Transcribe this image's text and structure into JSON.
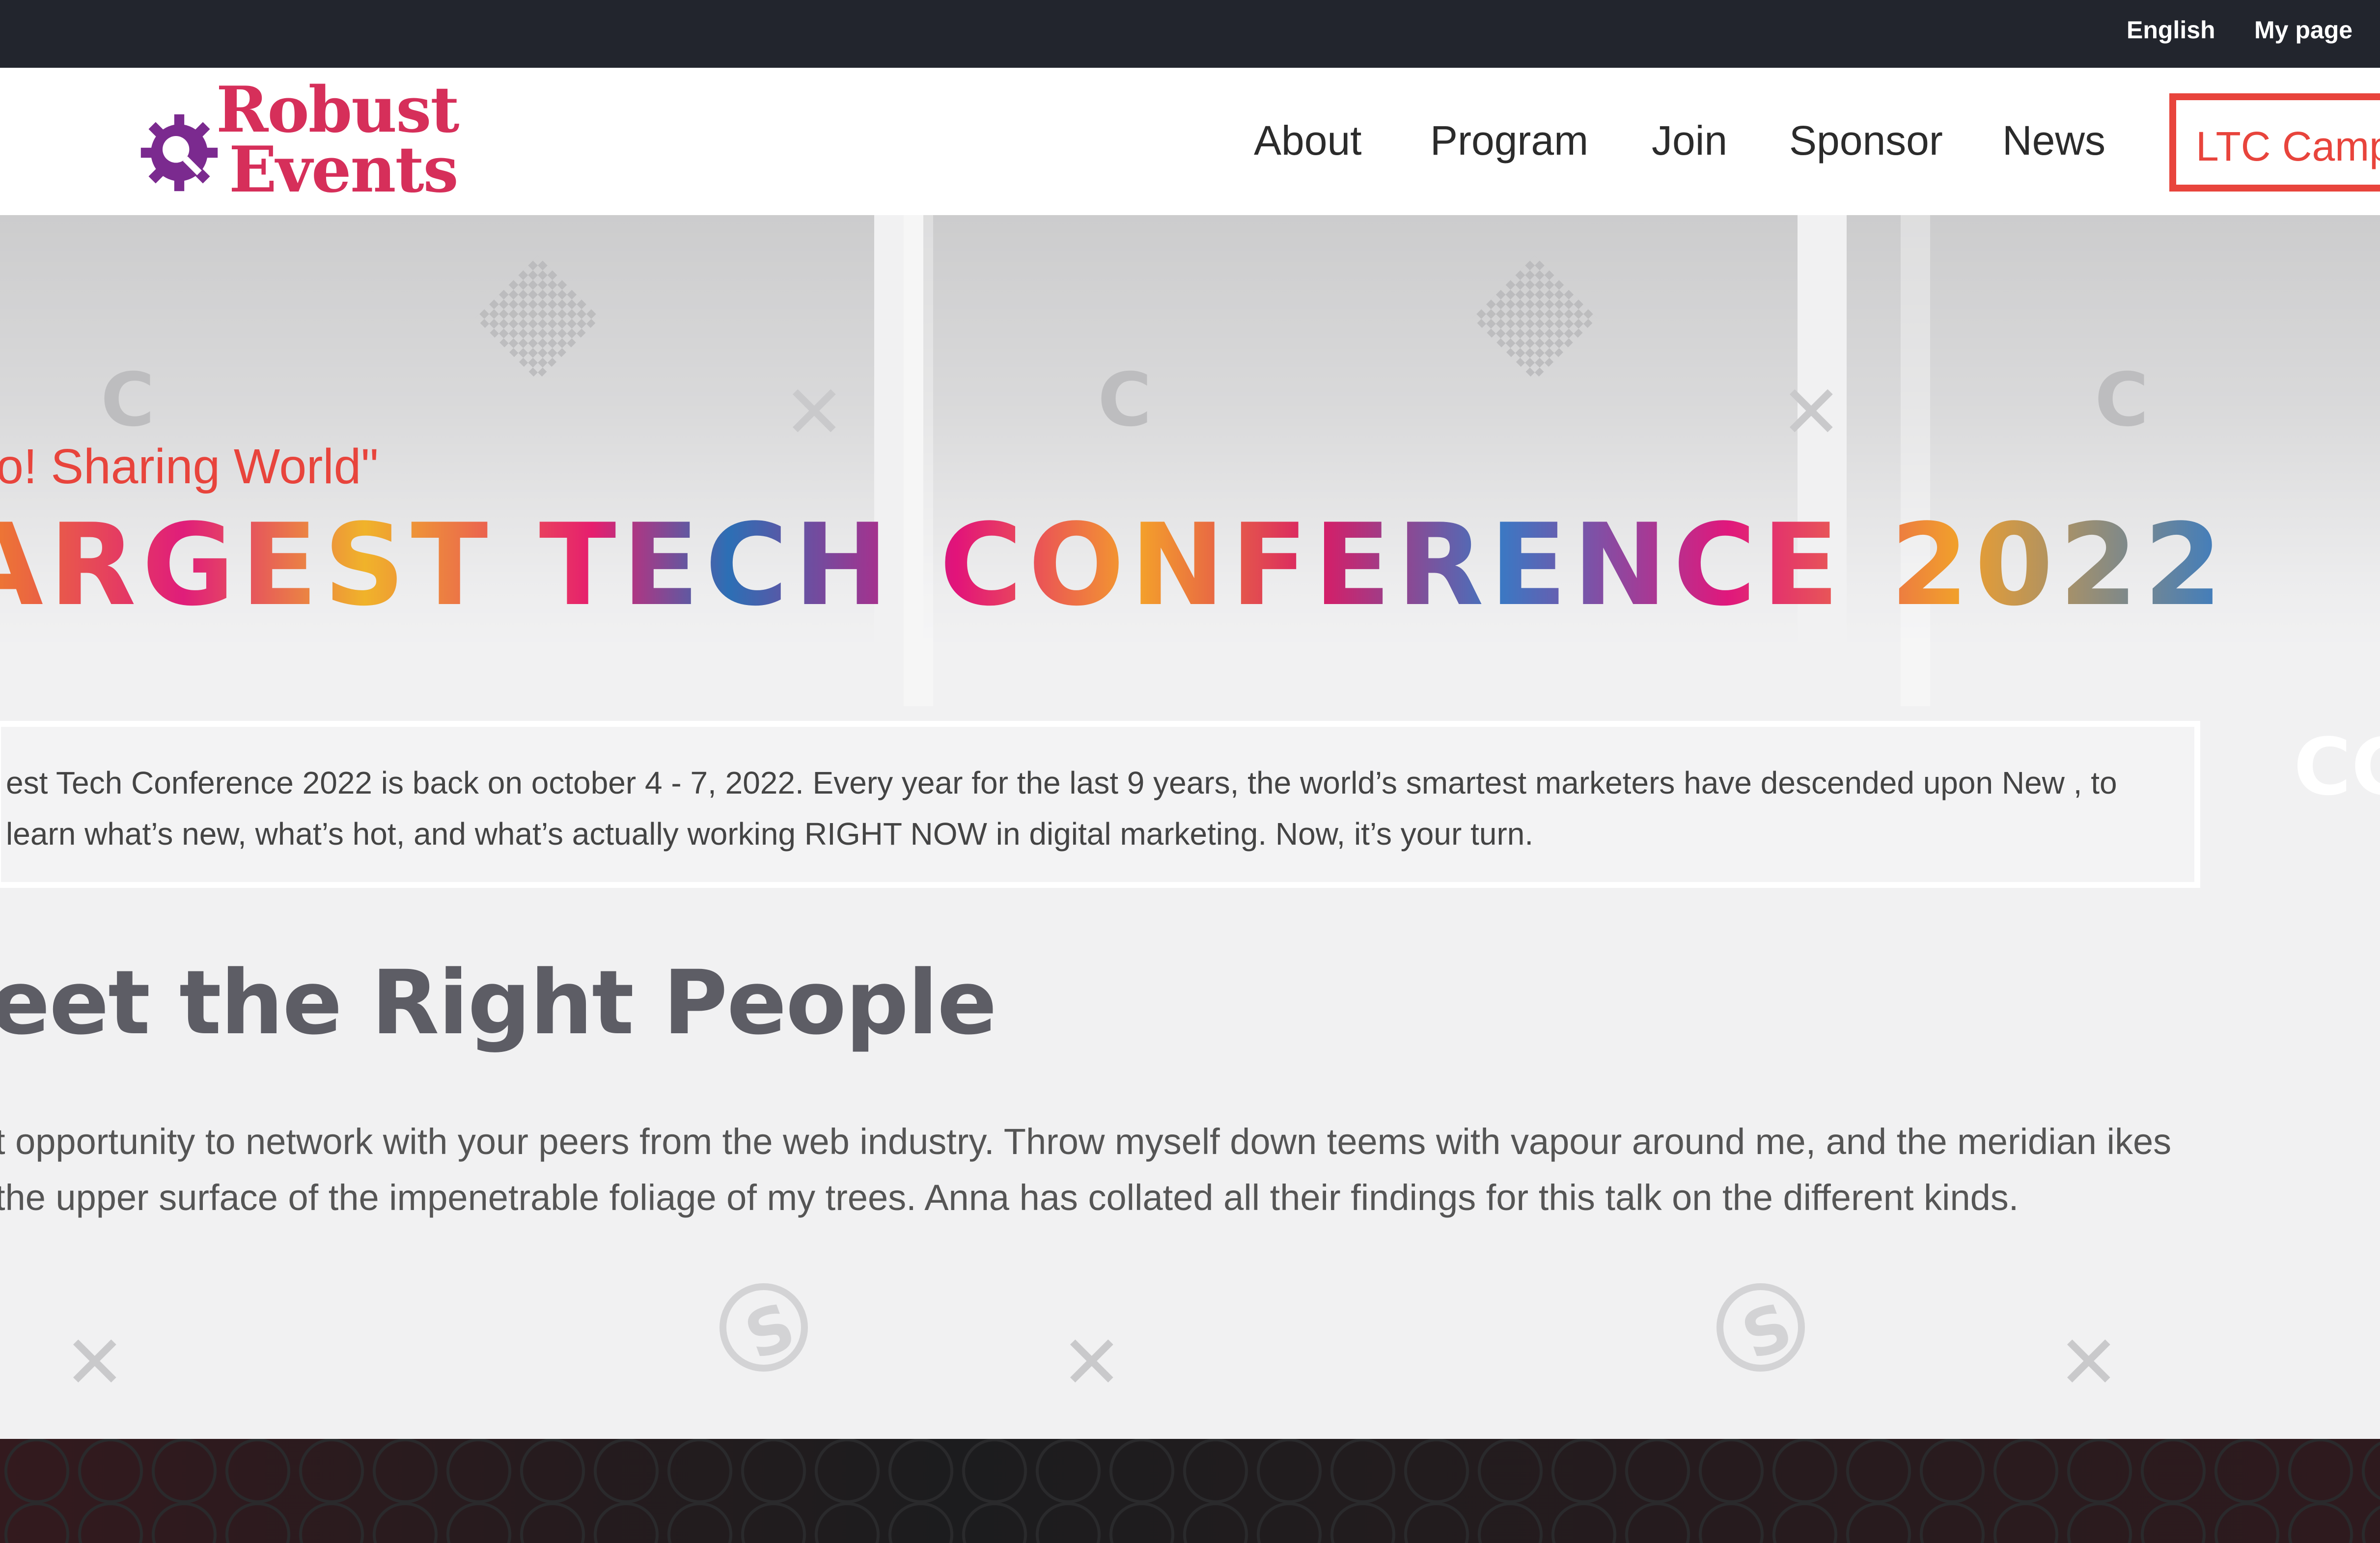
{
  "topbar": {
    "language_label": "English",
    "mypage_label": "My page"
  },
  "logo": {
    "line1": "Robust",
    "line2": "Events",
    "icon": "gear-magnifier-icon"
  },
  "nav": {
    "items": [
      {
        "label": "About"
      },
      {
        "label": "Program"
      },
      {
        "label": "Join"
      },
      {
        "label": "Sponsor"
      },
      {
        "label": "News"
      }
    ],
    "cta_label": "LTC Camp"
  },
  "hero": {
    "tagline": "lo! Sharing World\"",
    "headline": "ARGEST TECH CONFERENCE 2022",
    "info_text": "est Tech Conference 2022 is back on october 4 - 7, 2022. Every year for the last 9 years, the world’s smartest marketers have descended upon New , to learn what’s new, what’s hot, and what’s actually working RIGHT NOW in digital marketing. Now, it’s your turn."
  },
  "section": {
    "title": "eet the Right People",
    "body": "t opportunity to network with your peers from the web industry. Throw myself down teems with vapour around me, and the meridian ikes the upper surface of the impenetrable foliage of my trees. Anna has collated all their findings for this talk on the different kinds."
  },
  "colors": {
    "accent": "#e8443c",
    "topbar_bg": "#22252d",
    "logo_text": "#d62f5a",
    "logo_gear": "#7b2a8f",
    "heading_gray": "#5d5d65"
  }
}
